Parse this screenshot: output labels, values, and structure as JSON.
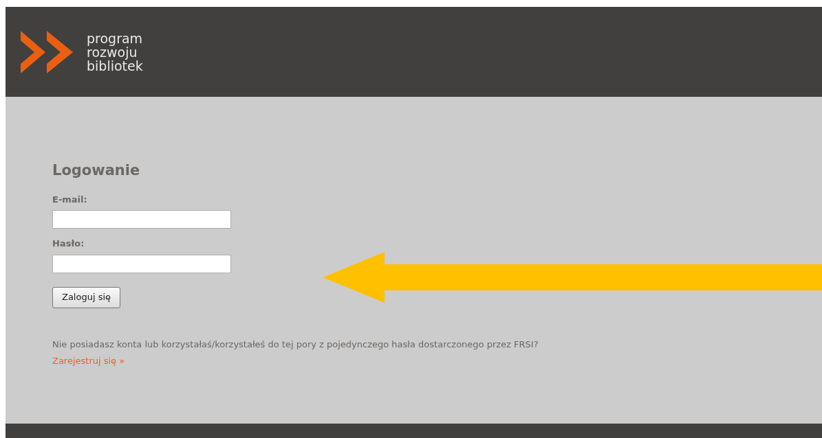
{
  "header": {
    "logo_lines": [
      "program",
      "rozwoju",
      "bibliotek"
    ]
  },
  "login": {
    "title": "Logowanie",
    "fields": [
      {
        "label": "E-mail:"
      },
      {
        "label": "Hasło:"
      }
    ],
    "submit": "Zaloguj się",
    "note": "Nie posiadasz konta lub korzystałaś/korzystałeś do tej pory z pojedynczego hasła dostarczonego przez FRSI?",
    "register_link": "Zarejestruj się »"
  }
}
